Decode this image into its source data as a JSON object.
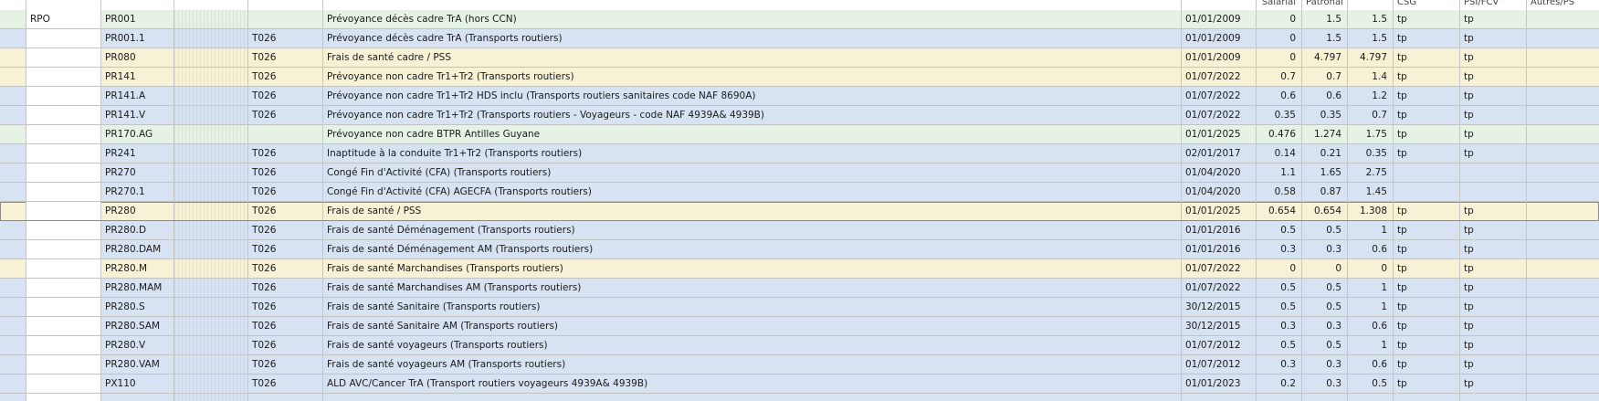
{
  "header": {
    "col_salarial": "Salarial",
    "col_patronal": "Patronal",
    "col_csg": "CSG",
    "col_psifcv": "PSI/FCV",
    "col_autres": "Autres/PS"
  },
  "colors": {
    "green": "#e6f2e4",
    "blue": "#d7e3f2",
    "yellow": "#f7f2d5",
    "grid": "#c6c6c6"
  },
  "rows": [
    {
      "group": "RPO",
      "code": "PR001",
      "ref": "",
      "label": "Prévoyance décès cadre TrA (hors CCN)",
      "date": "01/01/2009",
      "sal": "0",
      "pat": "1.5",
      "tot": "1.5",
      "csg": "tp",
      "psi": "tp",
      "color": "green"
    },
    {
      "group": "",
      "code": "PR001.1",
      "ref": "T026",
      "label": "Prévoyance décès cadre TrA (Transports routiers)",
      "date": "01/01/2009",
      "sal": "0",
      "pat": "1.5",
      "tot": "1.5",
      "csg": "tp",
      "psi": "tp",
      "color": "blue"
    },
    {
      "group": "",
      "code": "PR080",
      "ref": "T026",
      "label": "Frais de santé cadre / PSS",
      "date": "01/01/2009",
      "sal": "0",
      "pat": "4.797",
      "tot": "4.797",
      "csg": "tp",
      "psi": "tp",
      "color": "yellow"
    },
    {
      "group": "",
      "code": "PR141",
      "ref": "T026",
      "label": "Prévoyance non cadre Tr1+Tr2 (Transports routiers)",
      "date": "01/07/2022",
      "sal": "0.7",
      "pat": "0.7",
      "tot": "1.4",
      "csg": "tp",
      "psi": "tp",
      "color": "yellow"
    },
    {
      "group": "",
      "code": "PR141.A",
      "ref": "T026",
      "label": "Prévoyance non cadre Tr1+Tr2 HDS inclu (Transports routiers sanitaires code NAF 8690A)",
      "date": "01/07/2022",
      "sal": "0.6",
      "pat": "0.6",
      "tot": "1.2",
      "csg": "tp",
      "psi": "tp",
      "color": "blue"
    },
    {
      "group": "",
      "code": "PR141.V",
      "ref": "T026",
      "label": "Prévoyance non cadre Tr1+Tr2 (Transports routiers - Voyageurs - code NAF 4939A& 4939B)",
      "date": "01/07/2022",
      "sal": "0.35",
      "pat": "0.35",
      "tot": "0.7",
      "csg": "tp",
      "psi": "tp",
      "color": "blue"
    },
    {
      "group": "",
      "code": "PR170.AG",
      "ref": "",
      "label": "Prévoyance non cadre BTPR Antilles Guyane",
      "date": "01/01/2025",
      "sal": "0.476",
      "pat": "1.274",
      "tot": "1.75",
      "csg": "tp",
      "psi": "tp",
      "color": "green"
    },
    {
      "group": "",
      "code": "PR241",
      "ref": "T026",
      "label": "Inaptitude à la conduite Tr1+Tr2 (Transports routiers)",
      "date": "02/01/2017",
      "sal": "0.14",
      "pat": "0.21",
      "tot": "0.35",
      "csg": "tp",
      "psi": "tp",
      "color": "blue"
    },
    {
      "group": "",
      "code": "PR270",
      "ref": "T026",
      "label": "Congé Fin d'Activité (CFA) (Transports routiers)",
      "date": "01/04/2020",
      "sal": "1.1",
      "pat": "1.65",
      "tot": "2.75",
      "csg": "",
      "psi": "",
      "color": "blue"
    },
    {
      "group": "",
      "code": "PR270.1",
      "ref": "T026",
      "label": "Congé Fin d'Activité (CFA) AGECFA (Transports routiers)",
      "date": "01/04/2020",
      "sal": "0.58",
      "pat": "0.87",
      "tot": "1.45",
      "csg": "",
      "psi": "",
      "color": "blue"
    },
    {
      "group": "",
      "code": "PR280",
      "ref": "T026",
      "label": "Frais de santé / PSS",
      "date": "01/01/2025",
      "sal": "0.654",
      "pat": "0.654",
      "tot": "1.308",
      "csg": "tp",
      "psi": "tp",
      "color": "yellow",
      "selected": true
    },
    {
      "group": "",
      "code": "PR280.D",
      "ref": "T026",
      "label": "Frais de santé Déménagement (Transports routiers)",
      "date": "01/01/2016",
      "sal": "0.5",
      "pat": "0.5",
      "tot": "1",
      "csg": "tp",
      "psi": "tp",
      "color": "blue"
    },
    {
      "group": "",
      "code": "PR280.DAM",
      "ref": "T026",
      "label": "Frais de santé Déménagement AM (Transports routiers)",
      "date": "01/01/2016",
      "sal": "0.3",
      "pat": "0.3",
      "tot": "0.6",
      "csg": "tp",
      "psi": "tp",
      "color": "blue"
    },
    {
      "group": "",
      "code": "PR280.M",
      "ref": "T026",
      "label": "Frais de santé Marchandises (Transports routiers)",
      "date": "01/07/2022",
      "sal": "0",
      "pat": "0",
      "tot": "0",
      "csg": "tp",
      "psi": "tp",
      "color": "yellow"
    },
    {
      "group": "",
      "code": "PR280.MAM",
      "ref": "T026",
      "label": "Frais de santé Marchandises AM (Transports routiers)",
      "date": "01/07/2022",
      "sal": "0.5",
      "pat": "0.5",
      "tot": "1",
      "csg": "tp",
      "psi": "tp",
      "color": "blue"
    },
    {
      "group": "",
      "code": "PR280.S",
      "ref": "T026",
      "label": "Frais de santé Sanitaire (Transports routiers)",
      "date": "30/12/2015",
      "sal": "0.5",
      "pat": "0.5",
      "tot": "1",
      "csg": "tp",
      "psi": "tp",
      "color": "blue"
    },
    {
      "group": "",
      "code": "PR280.SAM",
      "ref": "T026",
      "label": "Frais de santé Sanitaire AM (Transports routiers)",
      "date": "30/12/2015",
      "sal": "0.3",
      "pat": "0.3",
      "tot": "0.6",
      "csg": "tp",
      "psi": "tp",
      "color": "blue"
    },
    {
      "group": "",
      "code": "PR280.V",
      "ref": "T026",
      "label": "Frais de santé voyageurs (Transports routiers)",
      "date": "01/07/2012",
      "sal": "0.5",
      "pat": "0.5",
      "tot": "1",
      "csg": "tp",
      "psi": "tp",
      "color": "blue"
    },
    {
      "group": "",
      "code": "PR280.VAM",
      "ref": "T026",
      "label": "Frais de santé voyageurs AM (Transports routiers)",
      "date": "01/07/2012",
      "sal": "0.3",
      "pat": "0.3",
      "tot": "0.6",
      "csg": "tp",
      "psi": "tp",
      "color": "blue"
    },
    {
      "group": "",
      "code": "PX110",
      "ref": "T026",
      "label": "ALD AVC/Cancer TrA (Transport routiers voyageurs 4939A& 4939B)",
      "date": "01/01/2023",
      "sal": "0.2",
      "pat": "0.3",
      "tot": "0.5",
      "csg": "tp",
      "psi": "tp",
      "color": "blue"
    }
  ]
}
